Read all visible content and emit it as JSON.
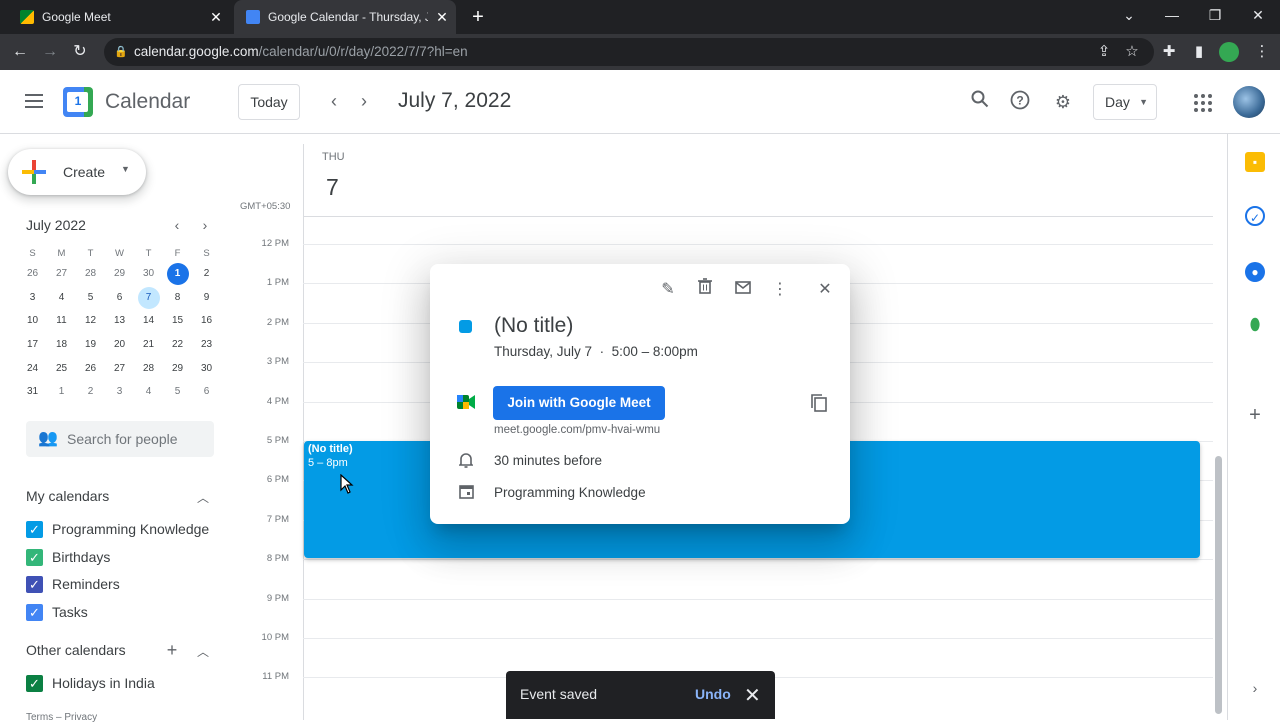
{
  "browser": {
    "tabs": [
      {
        "title": "Google Meet",
        "active": false
      },
      {
        "title": "Google Calendar - Thursday, July",
        "active": true
      }
    ],
    "url_host": "calendar.google.com",
    "url_path": "/calendar/u/0/r/day/2022/7/7?hl=en"
  },
  "header": {
    "app_name": "Calendar",
    "logo_number": "1",
    "today_label": "Today",
    "date_title": "July 7, 2022",
    "view_label": "Day"
  },
  "sidebar": {
    "create_label": "Create",
    "mini_cal": {
      "title": "July 2022",
      "weekdays": [
        "S",
        "M",
        "T",
        "W",
        "T",
        "F",
        "S"
      ],
      "weeks": [
        [
          "26",
          "27",
          "28",
          "29",
          "30",
          "1",
          "2"
        ],
        [
          "3",
          "4",
          "5",
          "6",
          "7",
          "8",
          "9"
        ],
        [
          "10",
          "11",
          "12",
          "13",
          "14",
          "15",
          "16"
        ],
        [
          "17",
          "18",
          "19",
          "20",
          "21",
          "22",
          "23"
        ],
        [
          "24",
          "25",
          "26",
          "27",
          "28",
          "29",
          "30"
        ],
        [
          "31",
          "1",
          "2",
          "3",
          "4",
          "5",
          "6"
        ]
      ]
    },
    "search_people_placeholder": "Search for people",
    "my_calendars_title": "My calendars",
    "my_calendars": [
      {
        "name": "Programming Knowledge",
        "color": "#039be5"
      },
      {
        "name": "Birthdays",
        "color": "#33b679"
      },
      {
        "name": "Reminders",
        "color": "#3f51b5"
      },
      {
        "name": "Tasks",
        "color": "#4285f4"
      }
    ],
    "other_calendars_title": "Other calendars",
    "other_calendars": [
      {
        "name": "Holidays in India",
        "color": "#0b8043"
      }
    ],
    "footer": "Terms – Privacy"
  },
  "day_view": {
    "day_name": "THU",
    "day_number": "7",
    "timezone": "GMT+05:30",
    "hours": [
      "12 PM",
      "1 PM",
      "2 PM",
      "3 PM",
      "4 PM",
      "5 PM",
      "6 PM",
      "7 PM",
      "8 PM",
      "9 PM",
      "10 PM",
      "11 PM"
    ],
    "event": {
      "title": "(No title)",
      "time": "5 – 8pm",
      "color": "#039be5"
    }
  },
  "popup": {
    "title": "(No title)",
    "date": "Thursday, July 7",
    "separator": "·",
    "time": "5:00 – 8:00pm",
    "join_label": "Join with Google Meet",
    "meet_url": "meet.google.com/pmv-hvai-wmu",
    "reminder": "30 minutes before",
    "calendar": "Programming Knowledge"
  },
  "snackbar": {
    "message": "Event saved",
    "action": "Undo"
  }
}
